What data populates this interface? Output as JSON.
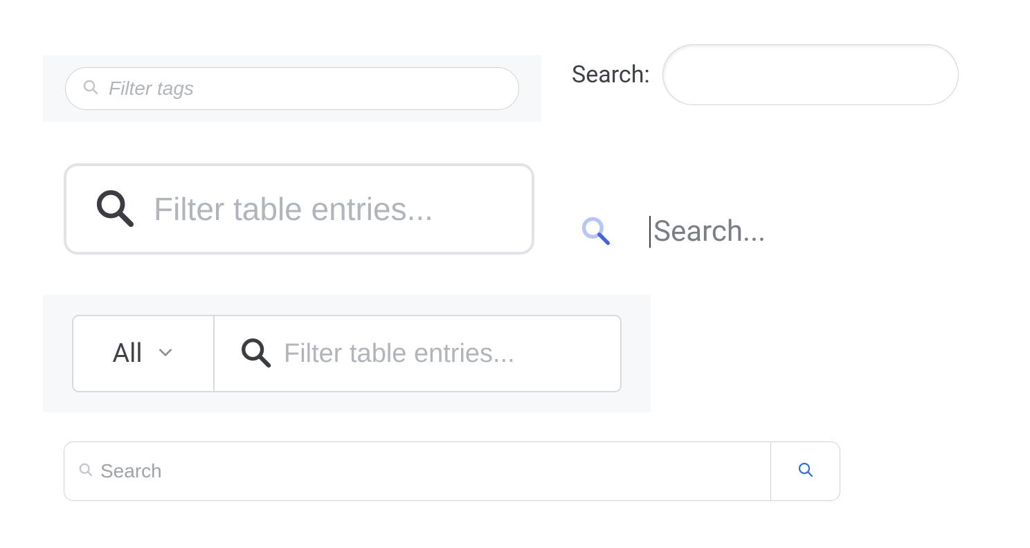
{
  "s1": {
    "placeholder": "Filter tags"
  },
  "s2": {
    "label": "Search:",
    "value": ""
  },
  "s3": {
    "placeholder": "Filter table entries..."
  },
  "s4": {
    "placeholder": "Search..."
  },
  "s5": {
    "dropdown": "All",
    "placeholder": "Filter table entries..."
  },
  "s6": {
    "placeholder": "Search"
  }
}
